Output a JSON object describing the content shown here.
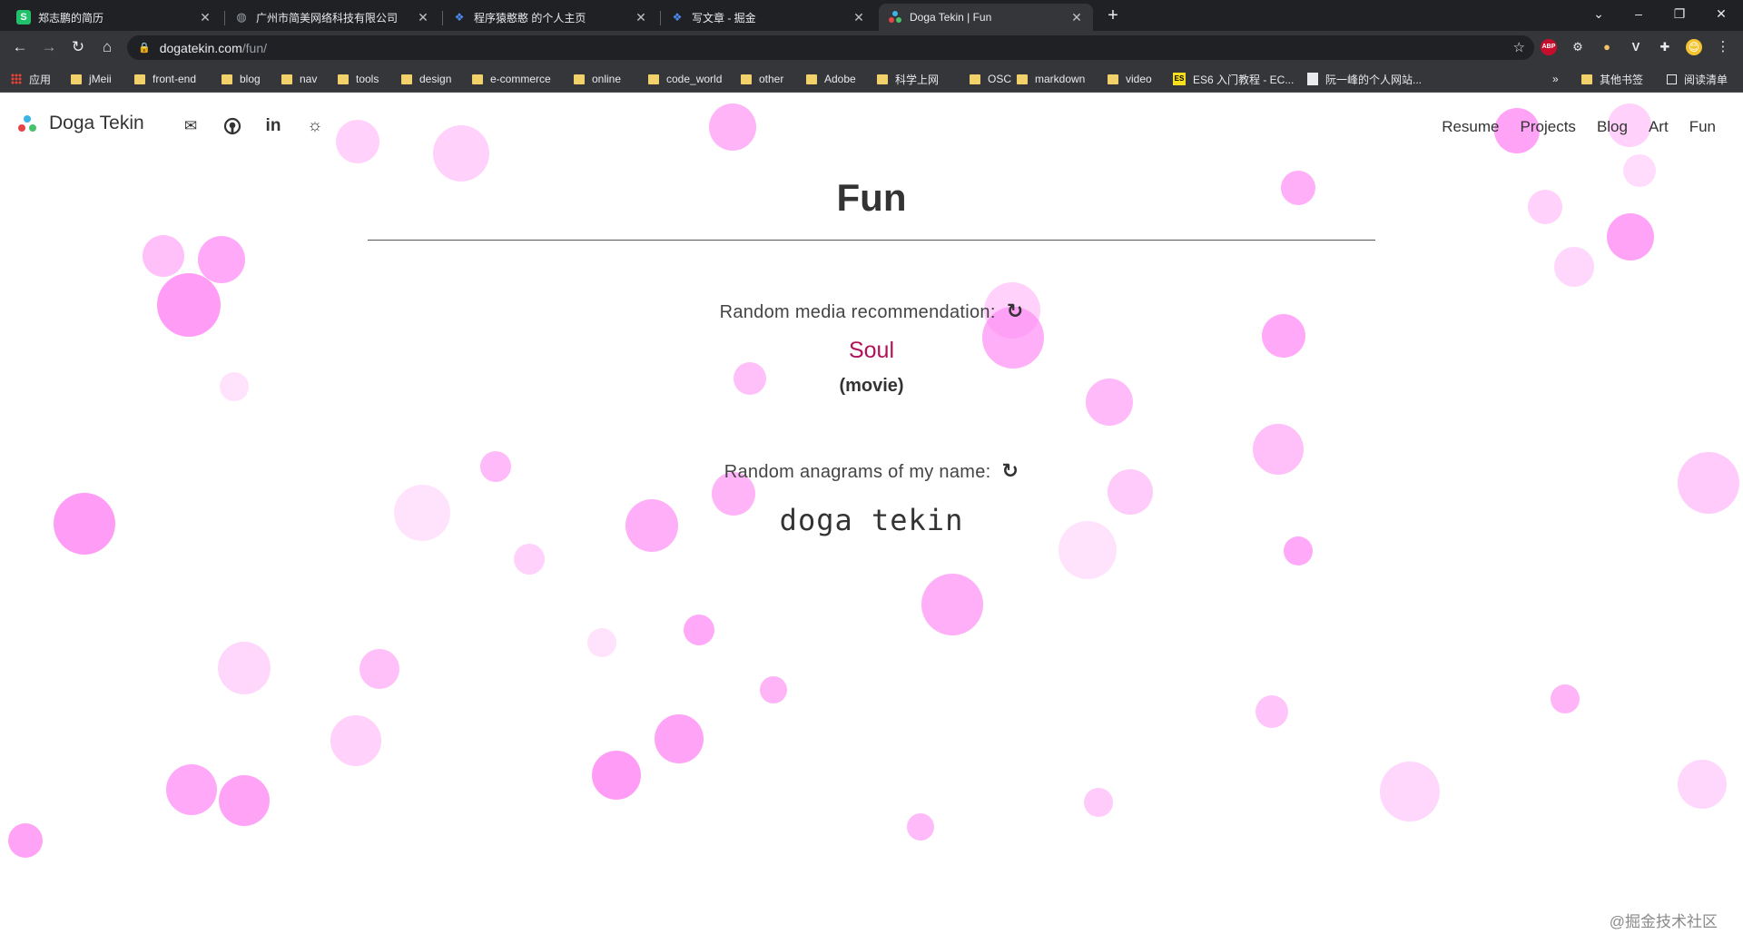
{
  "browser": {
    "tabs": [
      {
        "title": "郑志鹏的简历",
        "favicon": "S",
        "favicon_color": "#21c06b"
      },
      {
        "title": "广州市简美网络科技有限公司",
        "favicon": "globe",
        "favicon_color": "#9aa0a6"
      },
      {
        "title": "程序猿憨憨 的个人主页",
        "favicon": "juejin",
        "favicon_color": "#4c8bf5"
      },
      {
        "title": "写文章 - 掘金",
        "favicon": "juejin",
        "favicon_color": "#4c8bf5"
      },
      {
        "title": "Doga Tekin | Fun",
        "favicon": "dots",
        "favicon_color": "#e8eaed"
      }
    ],
    "url_host": "dogatekin.com",
    "url_path": "/fun/",
    "extensions": [
      {
        "label": "ABP",
        "color": "#c70d2c"
      },
      {
        "label": "⚙",
        "color": "#5f6368"
      },
      {
        "label": "●",
        "color": "#f5c26b"
      },
      {
        "label": "V",
        "color": "#5f6368"
      },
      {
        "label": "✚",
        "color": "#5f6368"
      },
      {
        "label": "😊",
        "color": "#f4c430"
      }
    ],
    "bookmarks": [
      {
        "label": "应用",
        "icon": "apps-grid"
      },
      {
        "label": "jMeii",
        "icon": "folder"
      },
      {
        "label": "front-end",
        "icon": "folder"
      },
      {
        "label": "blog",
        "icon": "folder"
      },
      {
        "label": "nav",
        "icon": "folder"
      },
      {
        "label": "tools",
        "icon": "folder"
      },
      {
        "label": "design",
        "icon": "folder"
      },
      {
        "label": "e-commerce",
        "icon": "folder"
      },
      {
        "label": "online",
        "icon": "folder"
      },
      {
        "label": "code_world",
        "icon": "folder"
      },
      {
        "label": "other",
        "icon": "folder"
      },
      {
        "label": "Adobe",
        "icon": "folder"
      },
      {
        "label": "科学上网",
        "icon": "folder"
      },
      {
        "label": "OSC",
        "icon": "folder"
      },
      {
        "label": "markdown",
        "icon": "folder"
      },
      {
        "label": "video",
        "icon": "folder"
      },
      {
        "label": "ES6 入门教程 - EC...",
        "icon": "es"
      },
      {
        "label": "阮一峰的个人网站...",
        "icon": "page"
      }
    ],
    "bookmarks_overflow": "»",
    "other_bookmarks": "其他书签",
    "reading_list": "阅读清单"
  },
  "site": {
    "brand": "Doga Tekin",
    "nav_icons": [
      "mail-icon",
      "github-icon",
      "linkedin-icon",
      "theme-toggle-icon"
    ],
    "nav_links": [
      "Resume",
      "Projects",
      "Blog",
      "Art",
      "Fun"
    ]
  },
  "main": {
    "title": "Fun",
    "media_label": "Random media recommendation:",
    "media_title": "Soul",
    "media_type": "(movie)",
    "anagram_label": "Random anagrams of my name:",
    "anagram": "doga tekin"
  },
  "watermark": "@掘金技术社区",
  "colors": {
    "accent_link": "#b0125a",
    "bubble": "#ff8cf5",
    "logo_dots": [
      "#e84545",
      "#3ab5e6",
      "#46c26b"
    ]
  }
}
